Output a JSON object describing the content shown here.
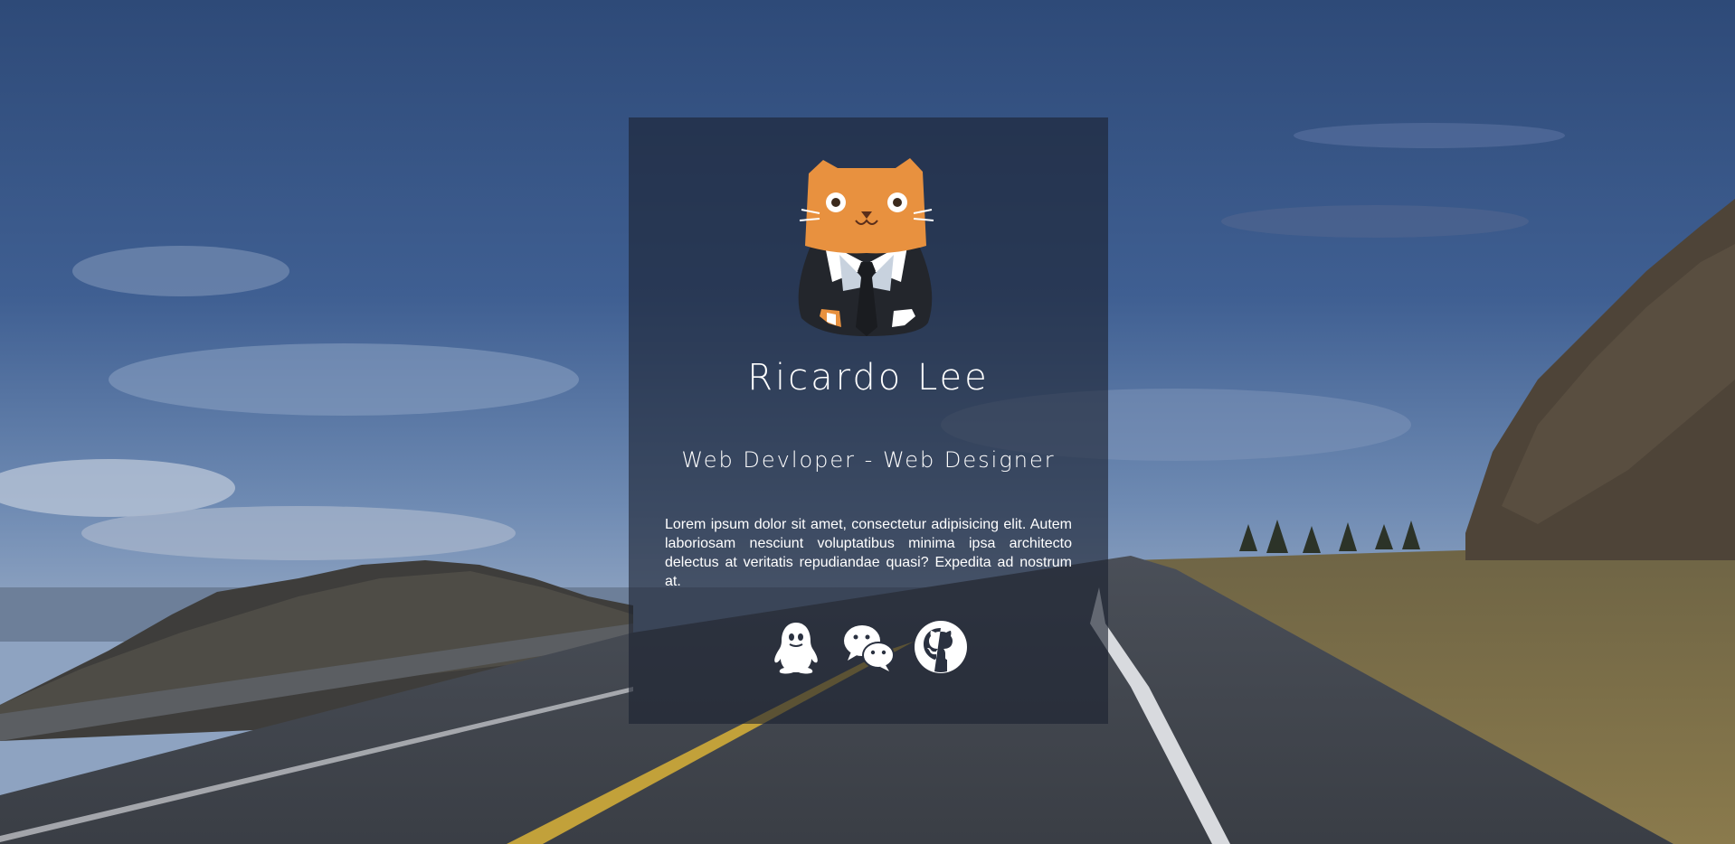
{
  "profile": {
    "name": "Ricardo Lee",
    "subtitle": "Web Devloper - Web Designer",
    "bio": "Lorem ipsum dolor sit amet, consectetur adipisicing elit. Autem laboriosam nesciunt voluptatibus minima ipsa architecto delectus at veritatis repudiandae quasi? Expedita ad nostrum at."
  },
  "avatar": {
    "icon": "cat-in-suit-avatar",
    "fur_color": "#e8913f"
  },
  "socials": [
    {
      "icon": "qq-penguin-icon"
    },
    {
      "icon": "wechat-icon"
    },
    {
      "icon": "github-icon"
    }
  ],
  "colors": {
    "card_overlay": "rgba(28,34,48,0.62)",
    "text": "#ffffff"
  }
}
